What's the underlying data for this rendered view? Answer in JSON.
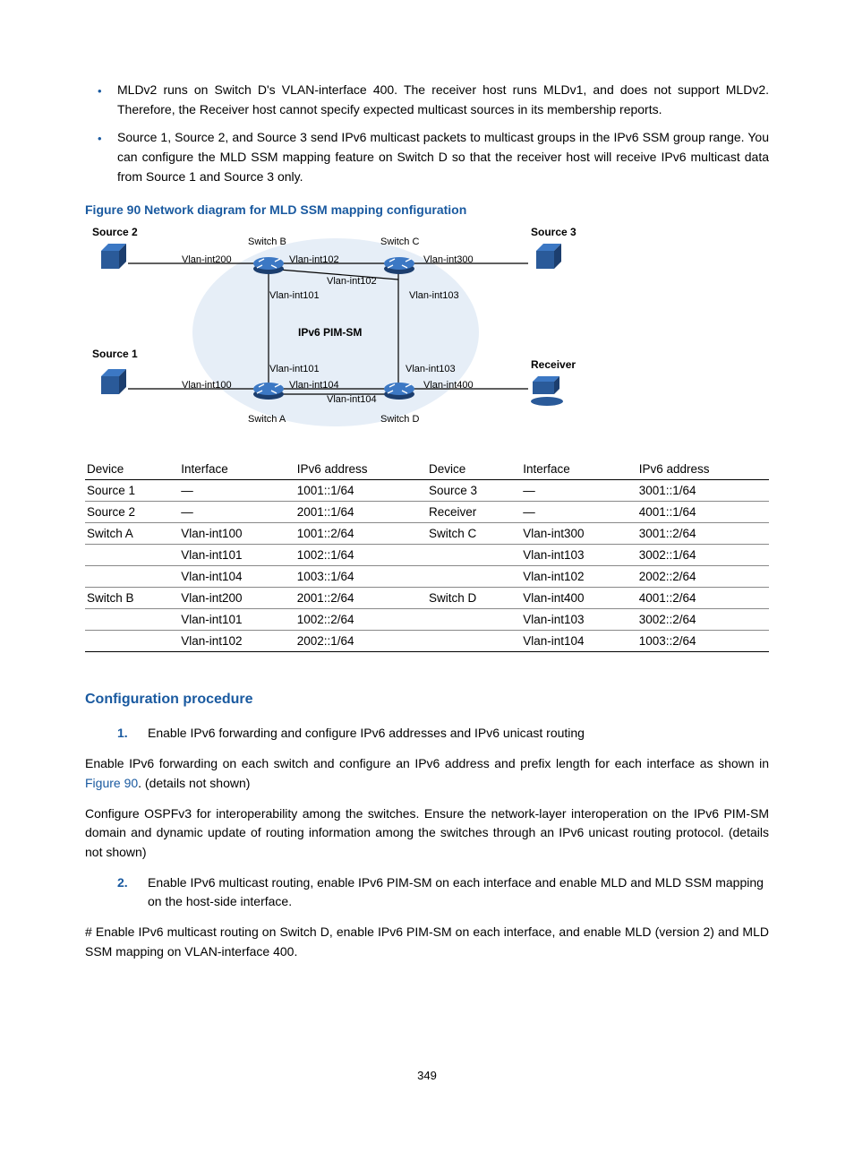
{
  "bullets": [
    "MLDv2 runs on Switch D's VLAN-interface 400. The receiver host runs MLDv1, and does not support MLDv2. Therefore, the Receiver host cannot specify expected multicast sources in its membership reports.",
    "Source 1, Source 2, and Source 3 send IPv6 multicast packets to multicast groups in the IPv6 SSM group range. You can configure the MLD SSM mapping feature on Switch D so that the receiver host will receive IPv6 multicast data from Source 1 and Source 3 only."
  ],
  "figure_caption": "Figure 90 Network diagram for MLD SSM mapping configuration",
  "diagram": {
    "source1": "Source 1",
    "source2": "Source 2",
    "source3": "Source 3",
    "receiver": "Receiver",
    "switchA": "Switch A",
    "switchB": "Switch B",
    "switchC": "Switch C",
    "switchD": "Switch D",
    "center": "IPv6 PIM-SM",
    "vlan100": "Vlan-int100",
    "vlan101a": "Vlan-int101",
    "vlan101b": "Vlan-int101",
    "vlan102a": "Vlan-int102",
    "vlan102b": "Vlan-int102",
    "vlan103a": "Vlan-int103",
    "vlan103b": "Vlan-int103",
    "vlan104a": "Vlan-int104",
    "vlan104b": "Vlan-int104",
    "vlan200": "Vlan-int200",
    "vlan300": "Vlan-int300",
    "vlan400": "Vlan-int400"
  },
  "table": {
    "headers": [
      "Device",
      "Interface",
      "IPv6 address",
      "Device",
      "Interface",
      "IPv6 address"
    ],
    "rows": [
      [
        "Source 1",
        "—",
        "1001::1/64",
        "Source 3",
        "—",
        "3001::1/64"
      ],
      [
        "Source 2",
        "—",
        "2001::1/64",
        "Receiver",
        "—",
        "4001::1/64"
      ],
      [
        "Switch A",
        "Vlan-int100",
        "1001::2/64",
        "Switch C",
        "Vlan-int300",
        "3001::2/64"
      ],
      [
        "",
        "Vlan-int101",
        "1002::1/64",
        "",
        "Vlan-int103",
        "3002::1/64"
      ],
      [
        "",
        "Vlan-int104",
        "1003::1/64",
        "",
        "Vlan-int102",
        "2002::2/64"
      ],
      [
        "Switch B",
        "Vlan-int200",
        "2001::2/64",
        "Switch D",
        "Vlan-int400",
        "4001::2/64"
      ],
      [
        "",
        "Vlan-int101",
        "1002::2/64",
        "",
        "Vlan-int103",
        "3002::2/64"
      ],
      [
        "",
        "Vlan-int102",
        "2002::1/64",
        "",
        "Vlan-int104",
        "1003::2/64"
      ]
    ]
  },
  "section_heading": "Configuration procedure",
  "steps": [
    {
      "num": "1.",
      "text": "Enable IPv6 forwarding and configure IPv6 addresses and IPv6 unicast routing"
    }
  ],
  "para1_a": "Enable IPv6 forwarding on each switch and configure an IPv6 address and prefix length for each interface as shown in ",
  "para1_link": "Figure 90",
  "para1_b": ". (details not shown)",
  "para2": "Configure OSPFv3 for interoperability among the switches. Ensure the network-layer interoperation on the IPv6 PIM-SM domain and dynamic update of routing information among the switches through an IPv6 unicast routing protocol. (details not shown)",
  "step2": {
    "num": "2.",
    "text": "Enable IPv6 multicast routing, enable IPv6 PIM-SM on each interface and enable MLD and MLD SSM mapping on the host-side interface."
  },
  "para3": "# Enable IPv6 multicast routing on Switch D, enable IPv6 PIM-SM on each interface, and enable MLD (version 2) and MLD SSM mapping on VLAN-interface 400.",
  "page_number": "349"
}
